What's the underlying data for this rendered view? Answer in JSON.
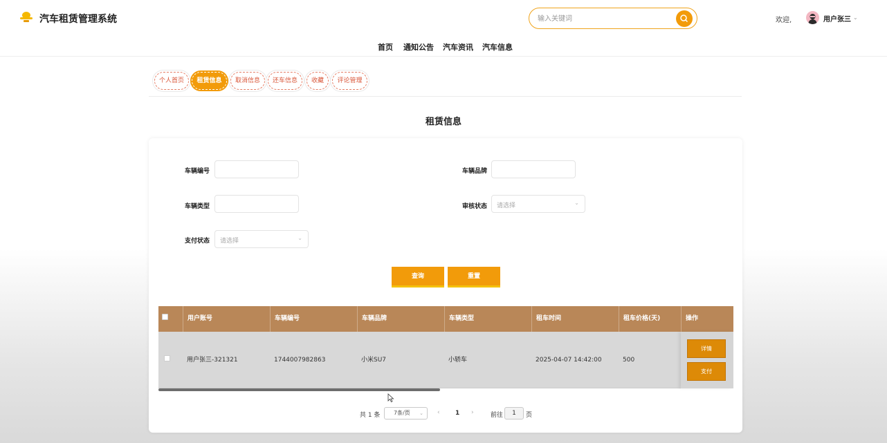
{
  "header": {
    "app_title": "汽车租赁管理系统",
    "search_placeholder": "输入关键词",
    "welcome": "欢迎,",
    "username": "用户张三"
  },
  "nav": {
    "items": [
      "首页",
      "通知公告",
      "汽车资讯",
      "汽车信息"
    ]
  },
  "tabs": [
    "个人首页",
    "租赁信息",
    "取消信息",
    "还车信息",
    "收藏",
    "评论管理"
  ],
  "active_tab": "租赁信息",
  "page_title": "租赁信息",
  "form": {
    "vehicle_no_label": "车辆编号",
    "vehicle_brand_label": "车辆品牌",
    "vehicle_type_label": "车辆类型",
    "review_status_label": "审核状态",
    "review_status_placeholder": "请选择",
    "pay_status_label": "支付状态",
    "pay_status_placeholder": "请选择",
    "query_button": "查询",
    "reset_button": "重置"
  },
  "table": {
    "headers": [
      "用户账号",
      "车辆编号",
      "车辆品牌",
      "车辆类型",
      "租车时间",
      "租车价格(天)",
      "操作"
    ],
    "rows": [
      {
        "account": "用户张三-321321",
        "vehicle_no": "1744007982863",
        "brand": "小米SU7",
        "type": "小轿车",
        "rent_time": "2025-04-07 14:42:00",
        "price": "500",
        "detail_button": "详情",
        "pay_button": "支付"
      }
    ]
  },
  "pagination": {
    "total": "共 1 条",
    "page_size": "7条/页",
    "current_page": "1",
    "goto_label": "前往",
    "goto_value": "1",
    "page_suffix": "页"
  },
  "colors": {
    "accent": "#f29b0a",
    "table_header": "#b98758",
    "tab_text": "#d9573a"
  }
}
